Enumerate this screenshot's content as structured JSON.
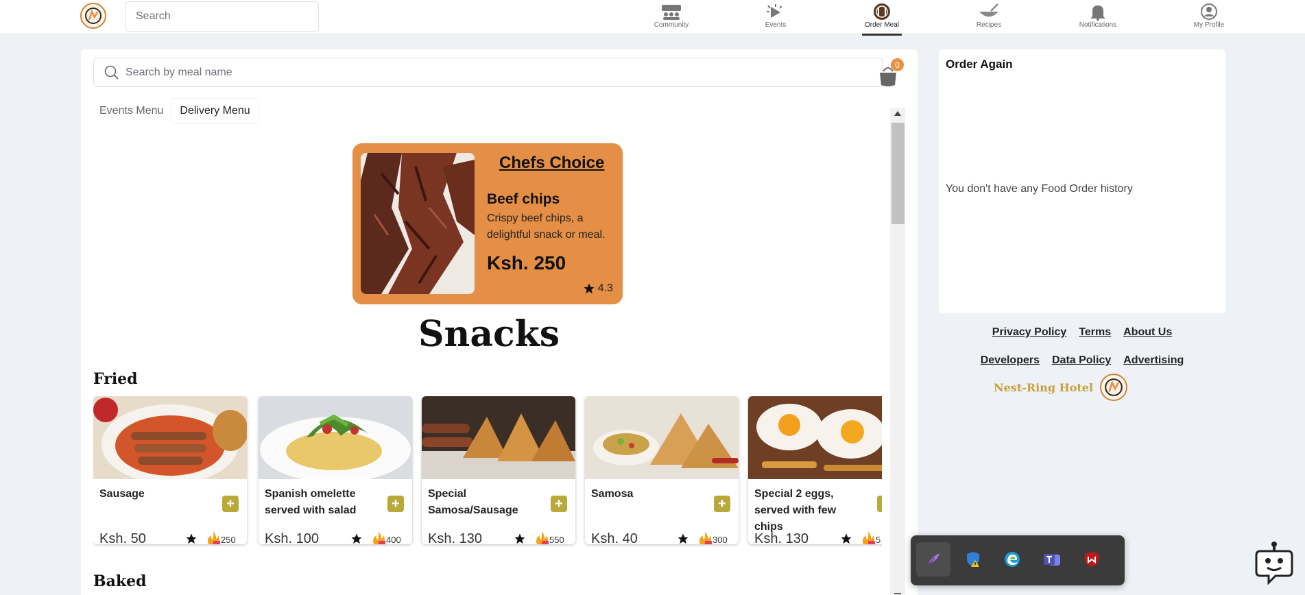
{
  "topnav": {
    "search_placeholder": "Search",
    "items": [
      {
        "label": "Community",
        "icon": "community-icon"
      },
      {
        "label": "Events",
        "icon": "events-icon"
      },
      {
        "label": "Order Meal",
        "icon": "order-meal-icon",
        "active": true
      },
      {
        "label": "Recipes",
        "icon": "recipes-icon"
      },
      {
        "label": "Notifications",
        "icon": "bell-icon"
      },
      {
        "label": "My Profile",
        "icon": "profile-icon"
      }
    ]
  },
  "meal_search": {
    "placeholder": "Search by meal name"
  },
  "cart": {
    "count": "0"
  },
  "tabs": [
    {
      "label": "Events Menu"
    },
    {
      "label": "Delivery Menu",
      "active": true
    }
  ],
  "chefs_choice": {
    "title": "Chefs Choice",
    "name": "Beef chips",
    "description": "Crispy beef chips, a delightful snack or meal.",
    "price": "Ksh. 250",
    "rating": "4.3"
  },
  "menu": {
    "section": "Snacks",
    "subsection": "Fried",
    "next_subsection": "Baked",
    "items": [
      {
        "name": "Sausage",
        "price": "Ksh. 50",
        "calories": "250"
      },
      {
        "name": "Spanish omelette served with salad",
        "price": "Ksh. 100",
        "calories": "400"
      },
      {
        "name": "Special Samosa/Sausage",
        "price": "Ksh. 130",
        "calories": "550"
      },
      {
        "name": "Samosa",
        "price": "Ksh. 40",
        "calories": "300"
      },
      {
        "name": "Special 2 eggs, served with few chips",
        "price": "Ksh. 130",
        "calories": "5"
      }
    ]
  },
  "order_again": {
    "title": "Order Again",
    "empty_text": "You don't have any Food Order history"
  },
  "footer": {
    "row1": [
      "Privacy Policy",
      "Terms",
      "About Us"
    ],
    "row2": [
      "Developers",
      "Data Policy",
      "Advertising"
    ],
    "brand": "Nest-Ring Hotel"
  },
  "colors": {
    "accent": "#e48f45",
    "add_button": "#b9a83a",
    "brand_text": "#c6a23a"
  }
}
